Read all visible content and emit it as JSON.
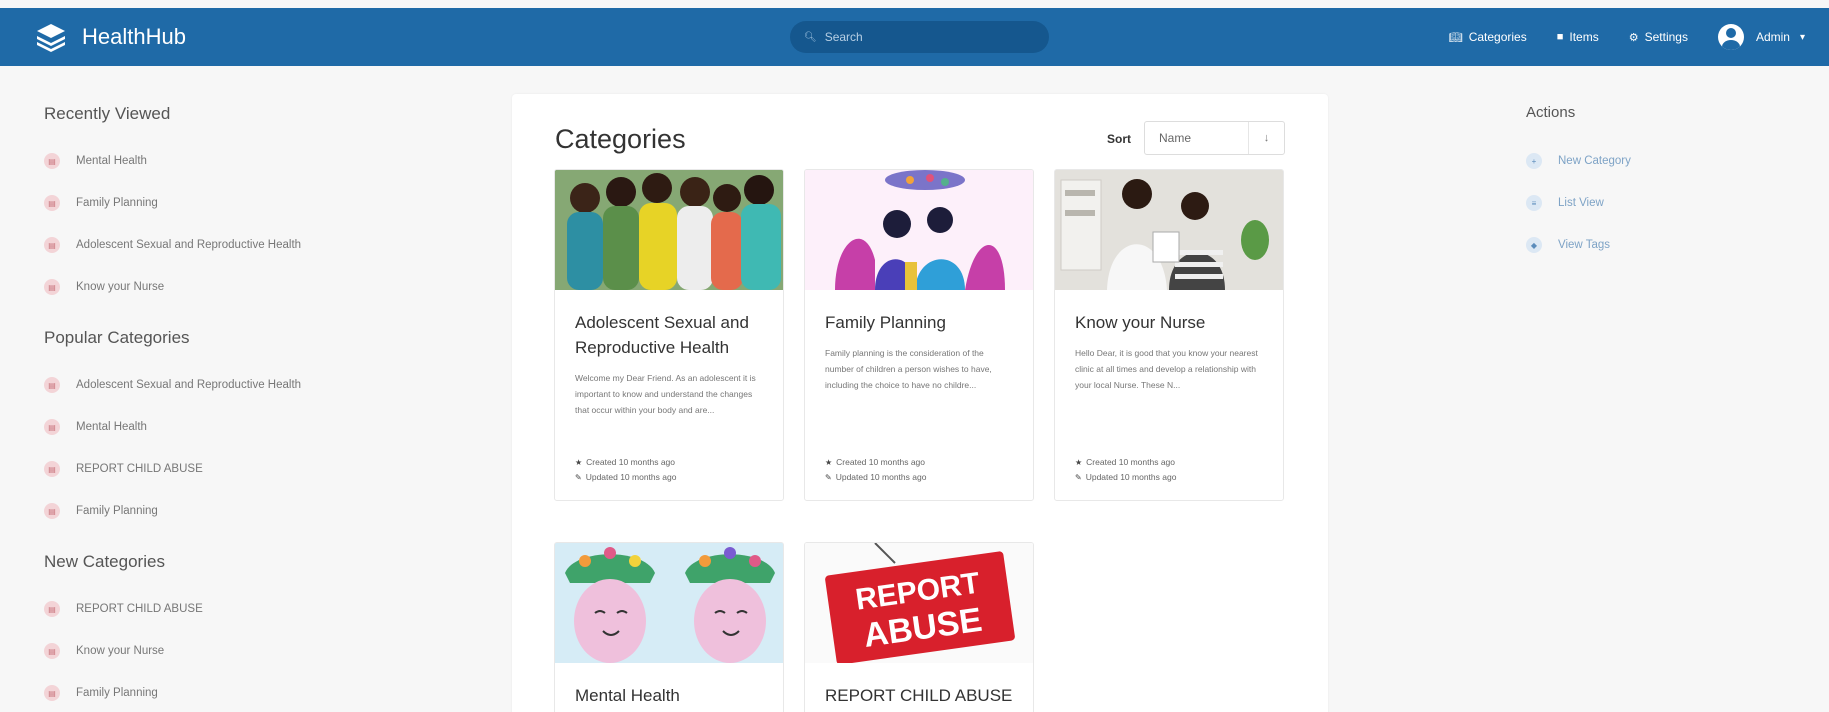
{
  "app": {
    "name": "HealthHub"
  },
  "search": {
    "placeholder": "Search"
  },
  "nav": {
    "categories": "Categories",
    "items": "Items",
    "settings": "Settings",
    "user": "Admin"
  },
  "sidebar": {
    "recent": {
      "heading": "Recently Viewed",
      "items": [
        "Mental Health",
        "Family Planning",
        "Adolescent Sexual and Reproductive Health",
        "Know your Nurse"
      ]
    },
    "popular": {
      "heading": "Popular Categories",
      "items": [
        "Adolescent Sexual and Reproductive Health",
        "Mental Health",
        "REPORT CHILD ABUSE",
        "Family Planning"
      ]
    },
    "newest": {
      "heading": "New Categories",
      "items": [
        "REPORT CHILD ABUSE",
        "Know your Nurse",
        "Family Planning"
      ]
    }
  },
  "main": {
    "title": "Categories",
    "sort": {
      "label": "Sort",
      "value": "Name",
      "direction_icon": "↓"
    },
    "cards": [
      {
        "title": "Adolescent Sexual and Reproductive Health",
        "description": "Welcome my Dear Friend. As an adolescent it is important to know and understand the changes that occur within your body and are...",
        "created": "Created 10 months ago",
        "updated": "Updated 10 months ago",
        "image_icon": "group-of-teens-photo"
      },
      {
        "title": "Family Planning",
        "description": "Family planning is the consideration of the number of children a person wishes to have, including the choice to have no childre...",
        "created": "Created 10 months ago",
        "updated": "Updated 10 months ago",
        "image_icon": "couple-illustration"
      },
      {
        "title": "Know your Nurse",
        "description": "Hello Dear, it is good that you know your nearest clinic at all times and develop a relationship with your local Nurse. These N...",
        "created": "Created 10 months ago",
        "updated": "Updated 10 months ago",
        "image_icon": "nurse-photo"
      },
      {
        "title": "Mental Health",
        "image_icon": "mental-health-illustration"
      },
      {
        "title": "REPORT CHILD ABUSE",
        "image_icon": "report-abuse-sign",
        "image_text_line1": "REPORT",
        "image_text_line2": "ABUSE"
      }
    ]
  },
  "actions": {
    "heading": "Actions",
    "items": [
      "New Category",
      "List View",
      "View Tags"
    ]
  },
  "colors": {
    "header": "#1f6aa7",
    "accent": "#7ea3c6"
  }
}
